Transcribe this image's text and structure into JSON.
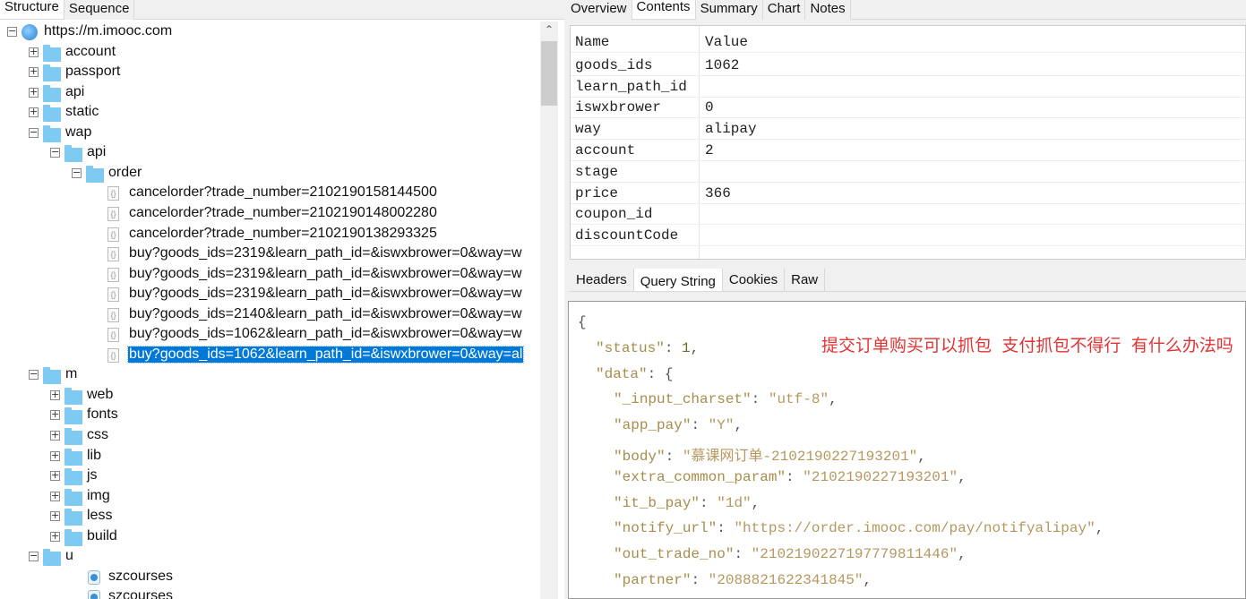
{
  "left_tabs": [
    {
      "label": "Structure",
      "active": true
    },
    {
      "label": "Sequence",
      "active": false
    }
  ],
  "tree": [
    {
      "label": "https://m.imooc.com",
      "type": "host",
      "level": 0,
      "toggle": "minus"
    },
    {
      "label": "account",
      "type": "folder",
      "level": 1,
      "toggle": "plus"
    },
    {
      "label": "passport",
      "type": "folder",
      "level": 1,
      "toggle": "plus"
    },
    {
      "label": "api",
      "type": "folder",
      "level": 1,
      "toggle": "plus"
    },
    {
      "label": "static",
      "type": "folder",
      "level": 1,
      "toggle": "plus"
    },
    {
      "label": "wap",
      "type": "folder",
      "level": 1,
      "toggle": "minus"
    },
    {
      "label": "api",
      "type": "folder",
      "level": 2,
      "toggle": "minus"
    },
    {
      "label": "order",
      "type": "folder",
      "level": 3,
      "toggle": "minus"
    },
    {
      "label": "cancelorder?trade_number=2102190158144500",
      "type": "file",
      "level": 4
    },
    {
      "label": "cancelorder?trade_number=2102190148002280",
      "type": "file",
      "level": 4
    },
    {
      "label": "cancelorder?trade_number=2102190138293325",
      "type": "file",
      "level": 4
    },
    {
      "label": "buy?goods_ids=2319&learn_path_id=&iswxbrower=0&way=w",
      "type": "file",
      "level": 4
    },
    {
      "label": "buy?goods_ids=2319&learn_path_id=&iswxbrower=0&way=w",
      "type": "file",
      "level": 4
    },
    {
      "label": "buy?goods_ids=2319&learn_path_id=&iswxbrower=0&way=w",
      "type": "file",
      "level": 4
    },
    {
      "label": "buy?goods_ids=2140&learn_path_id=&iswxbrower=0&way=w",
      "type": "file",
      "level": 4
    },
    {
      "label": "buy?goods_ids=1062&learn_path_id=&iswxbrower=0&way=w",
      "type": "file",
      "level": 4
    },
    {
      "label": "buy?goods_ids=1062&learn_path_id=&iswxbrower=0&way=al",
      "type": "file",
      "level": 4,
      "selected": true
    },
    {
      "label": "m",
      "type": "folder",
      "level": 1,
      "toggle": "minus"
    },
    {
      "label": "web",
      "type": "folder",
      "level": 2,
      "toggle": "plus"
    },
    {
      "label": "fonts",
      "type": "folder",
      "level": 2,
      "toggle": "plus"
    },
    {
      "label": "css",
      "type": "folder",
      "level": 2,
      "toggle": "plus"
    },
    {
      "label": "lib",
      "type": "folder",
      "level": 2,
      "toggle": "plus"
    },
    {
      "label": "js",
      "type": "folder",
      "level": 2,
      "toggle": "plus"
    },
    {
      "label": "img",
      "type": "folder",
      "level": 2,
      "toggle": "plus"
    },
    {
      "label": "less",
      "type": "folder",
      "level": 2,
      "toggle": "plus"
    },
    {
      "label": "build",
      "type": "folder",
      "level": 2,
      "toggle": "plus"
    },
    {
      "label": "u",
      "type": "folder",
      "level": 1,
      "toggle": "minus"
    },
    {
      "label": "szcourses",
      "type": "resource",
      "level": 2
    },
    {
      "label": "szcourses",
      "type": "resource",
      "level": 2
    }
  ],
  "right_tabs": [
    {
      "label": "Overview",
      "active": false
    },
    {
      "label": "Contents",
      "active": true
    },
    {
      "label": "Summary",
      "active": false
    },
    {
      "label": "Chart",
      "active": false
    },
    {
      "label": "Notes",
      "active": false
    }
  ],
  "params_table": {
    "headers": [
      "Name",
      "Value"
    ],
    "rows": [
      [
        "goods_ids",
        "1062"
      ],
      [
        "learn_path_id",
        ""
      ],
      [
        "iswxbrower",
        "0"
      ],
      [
        "way",
        "alipay"
      ],
      [
        "account",
        "2"
      ],
      [
        "stage",
        ""
      ],
      [
        "price",
        "366"
      ],
      [
        "coupon_id",
        ""
      ],
      [
        "discountCode",
        ""
      ]
    ]
  },
  "bottom_tabs": [
    {
      "label": "Headers",
      "active": false
    },
    {
      "label": "Query String",
      "active": true
    },
    {
      "label": "Cookies",
      "active": false
    },
    {
      "label": "Raw",
      "active": false
    }
  ],
  "json_lines": [
    {
      "indent": 0,
      "text": "{"
    },
    {
      "indent": 1,
      "key": "status",
      "num": "1"
    },
    {
      "indent": 1,
      "key": "data",
      "open": "{"
    },
    {
      "indent": 2,
      "key": "_input_charset",
      "str": "utf-8"
    },
    {
      "indent": 2,
      "key": "app_pay",
      "str": "Y"
    },
    {
      "indent": 2,
      "key": "body",
      "str": "慕课网订单-2102190227193201"
    },
    {
      "indent": 2,
      "key": "extra_common_param",
      "str": "2102190227193201"
    },
    {
      "indent": 2,
      "key": "it_b_pay",
      "str": "1d"
    },
    {
      "indent": 2,
      "key": "notify_url",
      "str": "https://order.imooc.com/pay/notifyalipay"
    },
    {
      "indent": 2,
      "key": "out_trade_no",
      "str": "2102190227197779811446"
    },
    {
      "indent": 2,
      "key": "partner",
      "str": "2088821622341845"
    }
  ],
  "annotation": "提交订单购买可以抓包  支付抓包不得行 有什么办法吗",
  "colors": {
    "selection": "#0078d7",
    "folder": "#7fcaf2",
    "annotation": "#e53333",
    "json_key": "#a98c4c"
  }
}
